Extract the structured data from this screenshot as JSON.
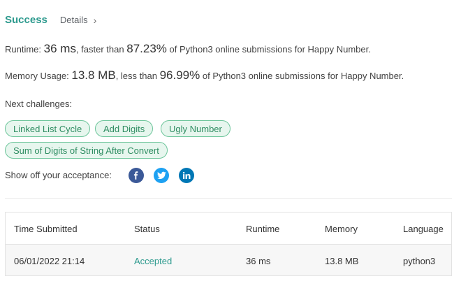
{
  "result": {
    "status": "Success",
    "details_label": "Details",
    "details_chevron": "›"
  },
  "runtime": {
    "prefix": "Runtime:",
    "value": "36 ms",
    "middle": ", faster than",
    "percent": "87.23%",
    "suffix": "of Python3 online submissions for Happy Number."
  },
  "memory": {
    "prefix": "Memory Usage:",
    "value": "13.8 MB",
    "middle": ", less than",
    "percent": "96.99%",
    "suffix": "of Python3 online submissions for Happy Number."
  },
  "next_challenges": {
    "label": "Next challenges:",
    "items": [
      "Linked List Cycle",
      "Add Digits",
      "Ugly Number",
      "Sum of Digits of String After Convert"
    ]
  },
  "share": {
    "label": "Show off your acceptance:",
    "icons": [
      "facebook-icon",
      "twitter-icon",
      "linkedin-icon"
    ],
    "colors": {
      "facebook": "#3b5998",
      "twitter": "#1da1f2",
      "linkedin": "#0077b5"
    }
  },
  "submissions": {
    "columns": [
      "Time Submitted",
      "Status",
      "Runtime",
      "Memory",
      "Language"
    ],
    "rows": [
      {
        "time": "06/01/2022 21:14",
        "status": "Accepted",
        "runtime": "36 ms",
        "memory": "13.8 MB",
        "language": "python3"
      }
    ]
  },
  "colors": {
    "accent": "#2d9a8e",
    "chip_border": "#6cc59a",
    "chip_bg": "#e7f6ee"
  }
}
